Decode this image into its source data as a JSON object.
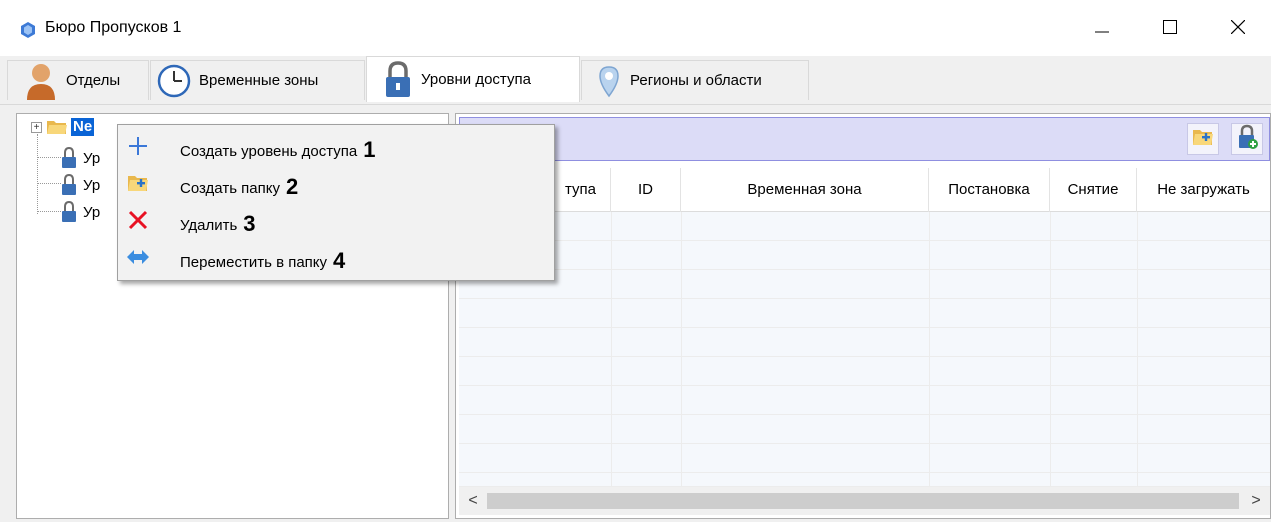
{
  "window": {
    "title": "Бюро Пропусков 1",
    "minimize": "minimize-icon",
    "maximize": "maximize-icon",
    "close": "close-icon"
  },
  "tabs": [
    {
      "label": "Отделы",
      "icon": "person-icon",
      "active": false
    },
    {
      "label": "Временные зоны",
      "icon": "clock-icon",
      "active": false
    },
    {
      "label": "Уровни доступа",
      "icon": "lock-icon",
      "active": true
    },
    {
      "label": "Регионы и области",
      "icon": "location-pin-icon",
      "active": false
    }
  ],
  "tree": {
    "root_label": "Ne",
    "children": [
      "Ур",
      "Ур",
      "Ур"
    ]
  },
  "toolbar": {
    "buttons": [
      "add-folder-icon",
      "add-access-level-icon"
    ]
  },
  "grid": {
    "columns": [
      "тупа",
      "ID",
      "Временная зона",
      "Постановка",
      "Снятие",
      "Не загружать"
    ]
  },
  "scrollbar": {
    "left": "<",
    "right": ">"
  },
  "context_menu": {
    "items": [
      {
        "label": "Создать уровень доступа",
        "number": "1",
        "icon": "plus-icon"
      },
      {
        "label": "Создать папку",
        "number": "2",
        "icon": "add-folder-icon"
      },
      {
        "label": "Удалить",
        "number": "3",
        "icon": "delete-x-icon"
      },
      {
        "label": "Переместить в папку",
        "number": "4",
        "icon": "move-arrows-icon"
      }
    ]
  },
  "colors": {
    "accent": "#0a64d6",
    "toolbar_bg": "#dcdcf7",
    "delete_red": "#e81123",
    "lock_blue": "#3a6fb5"
  }
}
